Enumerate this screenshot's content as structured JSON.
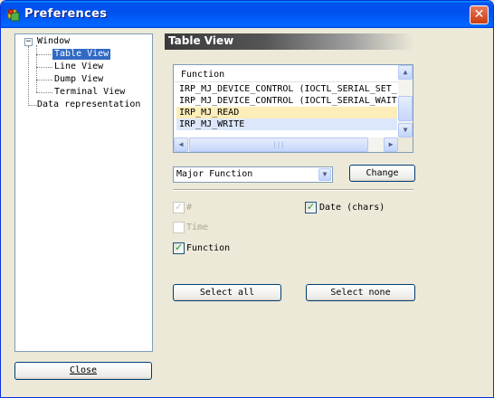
{
  "window": {
    "title": "Preferences",
    "close_glyph": "✕",
    "icon": "app-icon"
  },
  "tree": {
    "root": {
      "label": "Window",
      "expander": "−",
      "expanded": true
    },
    "children": [
      {
        "label": "Table View",
        "selected": true
      },
      {
        "label": "Line View",
        "selected": false
      },
      {
        "label": "Dump View",
        "selected": false
      },
      {
        "label": "Terminal View",
        "selected": false
      }
    ],
    "data_representation": "Data representation"
  },
  "footer": {
    "close_label": "Close"
  },
  "panel": {
    "title": "Table View",
    "list": {
      "column_header": "Function",
      "rows": [
        {
          "text": "IRP_MJ_DEVICE_CONTROL (IOCTL_SERIAL_SET_",
          "state": "normal"
        },
        {
          "text": "IRP_MJ_DEVICE_CONTROL (IOCTL_SERIAL_WAIT_",
          "state": "normal"
        },
        {
          "text": "IRP_MJ_READ",
          "state": "highlight-yellow"
        },
        {
          "text": "IRP_MJ_WRITE",
          "state": "highlight-blue"
        }
      ],
      "scroll_glyphs": {
        "up": "▲",
        "down": "▼",
        "left": "◀",
        "right": "▶",
        "grip": "|||"
      }
    },
    "filter": {
      "selected_value": "Major Function",
      "arrow": "▼"
    },
    "change_label": "Change",
    "options": {
      "hash": {
        "label": "#",
        "checked": true,
        "enabled": false
      },
      "time": {
        "label": "Time",
        "checked": false,
        "enabled": false
      },
      "function": {
        "label": "Function",
        "checked": true,
        "enabled": true
      },
      "date": {
        "label": "Date (chars)",
        "checked": true,
        "enabled": true
      },
      "check_glyph": "✓"
    },
    "select_all_label": "Select all",
    "select_none_label": "Select none"
  },
  "colors": {
    "selection": "#316ac5",
    "row_yellow": "#fdedb9",
    "row_blue": "#dce7fb",
    "title_bar": "#0053ee"
  }
}
